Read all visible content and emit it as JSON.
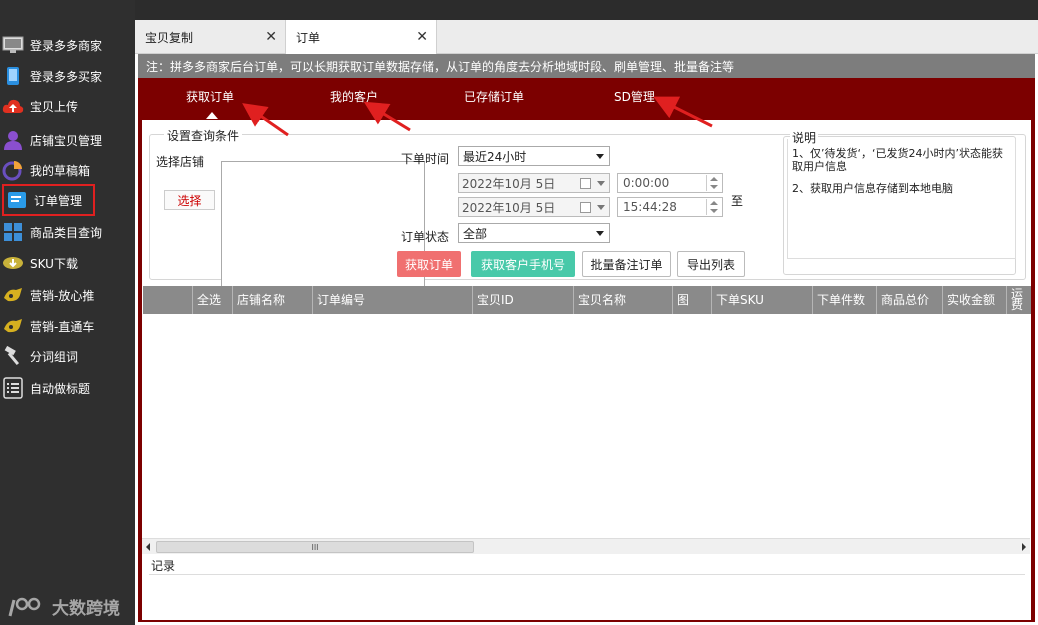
{
  "sidebar": {
    "items": [
      {
        "label": "登录多多商家",
        "icon": "monitor-icon"
      },
      {
        "label": "登录多多买家",
        "icon": "phone-icon"
      },
      {
        "label": "宝贝上传",
        "icon": "cloud-upload-icon"
      },
      {
        "label": "店铺宝贝管理",
        "icon": "user-icon"
      },
      {
        "label": "我的草稿箱",
        "icon": "pie-chart-icon"
      },
      {
        "label": "订单管理",
        "icon": "order-icon",
        "active": true
      },
      {
        "label": "商品类目查询",
        "icon": "grid-icon"
      },
      {
        "label": "SKU下载",
        "icon": "download-icon"
      },
      {
        "label": "营销-放心推",
        "icon": "promo-icon"
      },
      {
        "label": "营销-直通车",
        "icon": "car-icon"
      },
      {
        "label": "分词组词",
        "icon": "hammer-icon"
      },
      {
        "label": "自动做标题",
        "icon": "list-icon"
      }
    ],
    "logo_text": "大数跨境"
  },
  "tabs": [
    {
      "label": "宝贝复制",
      "close": "✕"
    },
    {
      "label": "订单",
      "close": "✕"
    }
  ],
  "note": "注：拼多多商家后台订单，可以长期获取订单数据存储，从订单的角度去分析地域时段、刷单管理、批量备注等",
  "subtabs": [
    "获取订单",
    "我的客户",
    "已存储订单",
    "SD管理"
  ],
  "query": {
    "legend": "设置查询条件",
    "store_label": "选择店铺",
    "select_button": "选择",
    "time_label": "下单时间",
    "time_value": "最近24小时",
    "start_date": "2022年10月 5日",
    "end_date": "2022年10月 5日",
    "start_time": "0:00:00",
    "end_time": "15:44:28",
    "to_label": "至",
    "status_label": "订单状态",
    "status_value": "全部",
    "buttons": {
      "fetch": "获取订单",
      "phone": "获取客户手机号",
      "batch_note": "批量备注订单",
      "export": "导出列表"
    }
  },
  "description": {
    "title": "说明",
    "line1": "1、仅’待发货‘，‘已发货24小时内’状态能获取用户信息",
    "line2": "2、获取用户信息存储到本地电脑"
  },
  "table": {
    "columns": [
      "",
      "全选",
      "店铺名称",
      "订单编号",
      "宝贝ID",
      "宝贝名称",
      "图",
      "下单SKU",
      "下单件数",
      "商品总价",
      "实收金额",
      "运费"
    ]
  },
  "scroll_thumb": "III",
  "record_label": "记录",
  "colors": {
    "sidebar_bg": "#2f2f2f",
    "panel_red": "#7c0000",
    "note_gray": "#7d7d7d",
    "annotation_red": "#e02020"
  }
}
